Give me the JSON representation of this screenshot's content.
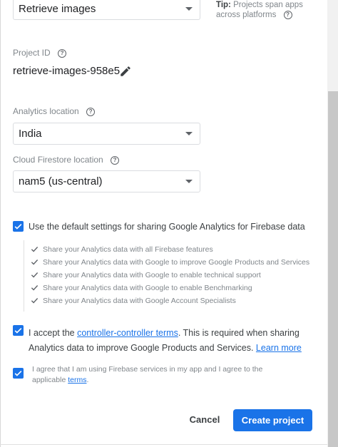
{
  "project_name": {
    "value": "Retrieve images"
  },
  "tip": {
    "label": "Tip:",
    "line1": "Projects span apps",
    "line2": "across platforms"
  },
  "project_id": {
    "label": "Project ID",
    "value": "retrieve-images-958e5"
  },
  "analytics_location": {
    "label": "Analytics location",
    "value": "India"
  },
  "firestore_location": {
    "label": "Cloud Firestore location",
    "value": "nam5 (us-central)"
  },
  "default_settings": {
    "label": "Use the default settings for sharing Google Analytics for Firebase data",
    "checked": true,
    "items": [
      "Share your Analytics data with all Firebase features",
      "Share your Analytics data with Google to improve Google Products and Services",
      "Share your Analytics data with Google to enable technical support",
      "Share your Analytics data with Google to enable Benchmarking",
      "Share your Analytics data with Google Account Specialists"
    ]
  },
  "accept_terms": {
    "prefix": "I accept the ",
    "link": "controller-controller terms",
    "suffix_line1": ". This is required when sharing",
    "line2": "Analytics data to improve Google Products and Services.",
    "learn_more": "Learn more",
    "checked": true
  },
  "firebase_terms": {
    "line1": "I agree that I am using Firebase services in my app and I agree to the",
    "line2_prefix": "applicable ",
    "link": "terms",
    "line2_suffix": ".",
    "checked": true
  },
  "actions": {
    "cancel": "Cancel",
    "create": "Create project"
  },
  "colors": {
    "accent": "#1a73e8"
  }
}
